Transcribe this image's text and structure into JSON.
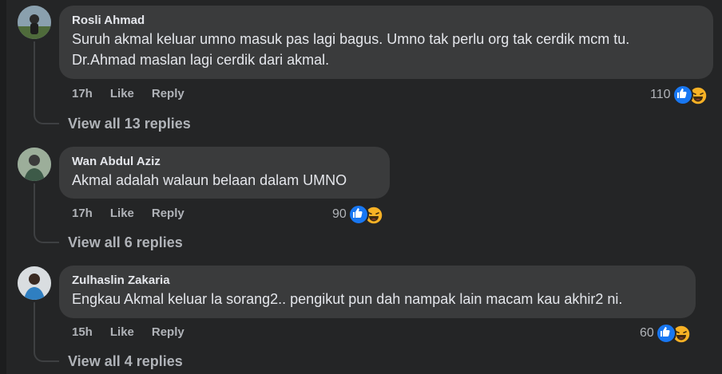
{
  "comments": [
    {
      "author": "Rosli Ahmad",
      "text": "Suruh akmal keluar umno masuk pas lagi bagus. Umno tak perlu org tak cerdik mcm tu.\nDr.Ahmad maslan lagi cerdik dari akmal.",
      "time": "17h",
      "like_label": "Like",
      "reply_label": "Reply",
      "reaction_count": "110",
      "view_replies": "View all 13 replies"
    },
    {
      "author": "Wan Abdul Aziz",
      "text": "Akmal adalah walaun belaan dalam UMNO",
      "time": "17h",
      "like_label": "Like",
      "reply_label": "Reply",
      "reaction_count": "90",
      "view_replies": "View all 6 replies"
    },
    {
      "author": "Zulhaslin Zakaria",
      "text": "Engkau Akmal keluar la sorang2.. pengikut pun dah nampak lain macam kau akhir2 ni.",
      "time": "15h",
      "like_label": "Like",
      "reply_label": "Reply",
      "reaction_count": "60",
      "view_replies": "View all 4 replies"
    }
  ],
  "colors": {
    "background": "#242526",
    "bubble": "#3a3b3c",
    "like_blue": "#1877f2",
    "haha_yellow": "#f7b125",
    "secondary_text": "#b0b3b8"
  }
}
